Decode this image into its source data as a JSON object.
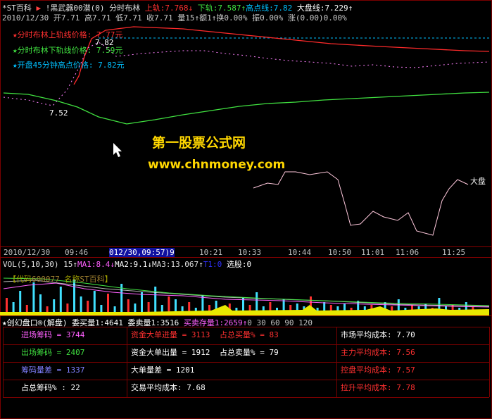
{
  "header": {
    "stock_name": "*ST百科",
    "indicator": "!黑武器00潜(0)",
    "chart_mode": "分时布林",
    "upper_label": "上轨:",
    "upper_val": "7.768",
    "lower_label": "下轨:",
    "lower_val": "7.587",
    "high_label": "高点线:",
    "high_val": "7.82",
    "market_label": "大盘线:",
    "market_val": "7.229",
    "date_line": "2010/12/30  开7.71  高7.71  低7.71  收7.71  量15",
    "date_line2": "额1",
    "date_line3": "换0.00%  振0.00%  涨(0.00)0.00%"
  },
  "legend": {
    "upper": "分时布林上轨线价格: 7.77元",
    "lower": "分时布林下轨线价格: 7.59元",
    "high45": "开盘45分钟高点价格: 7.82元"
  },
  "annotations": {
    "price_high": "7.82",
    "price_low": "7.52",
    "market_tag": "大盘"
  },
  "watermark": {
    "line1": "第一股票公式网",
    "line2": "www.chnmoney.com"
  },
  "time_axis": {
    "left_date": "2010/12/30",
    "cursor": "012/30,09:57)9",
    "ticks": [
      "09:46",
      "10:21",
      "10:33",
      "10:44",
      "10:50",
      "11:01",
      "11:06",
      "11:25"
    ]
  },
  "vol_bar": {
    "vol": "VOL(5,10,30)",
    "v15": "15",
    "ma1": "MA1:8.4",
    "ma2": "MA2:9.1",
    "ma3": "MA3:13.067",
    "t1": "T1:0",
    "xg": "选股:0"
  },
  "code_bar": {
    "code_label": "【代码",
    "code": "600077",
    "name_label": "名称",
    "name": "ST百科",
    "close": "】"
  },
  "disk_bar": {
    "title": "★创幻盘口®(解盘)",
    "buy": "委买量1:4641",
    "sell": "委卖量1:3516",
    "store": "买卖存量1:2659",
    "scale": "0   30  60  90  120"
  },
  "table": {
    "rows": [
      [
        "进场筹码 = 3744",
        "资金大单进量 = 3113",
        "占总买量% = 83",
        "市场平均成本: 7.70"
      ],
      [
        "出场筹码 = 2407",
        "资金大单出量 = 1912",
        "占总卖量% = 79",
        "主力平均成本: 7.56"
      ],
      [
        "筹码量差 = 1337",
        "大单量差 = 1201",
        "",
        "控盘平均成本: 7.57"
      ],
      [
        "占总筹码% : 22",
        "交易平均成本: 7.68",
        "",
        "拉升平均成本: 7.78"
      ]
    ]
  },
  "colors": {
    "upper": "#ff2a2a",
    "lower": "#40e040",
    "high": "#00c0ff",
    "market": "#ffd0e0",
    "watermark": "#ffd700"
  }
}
